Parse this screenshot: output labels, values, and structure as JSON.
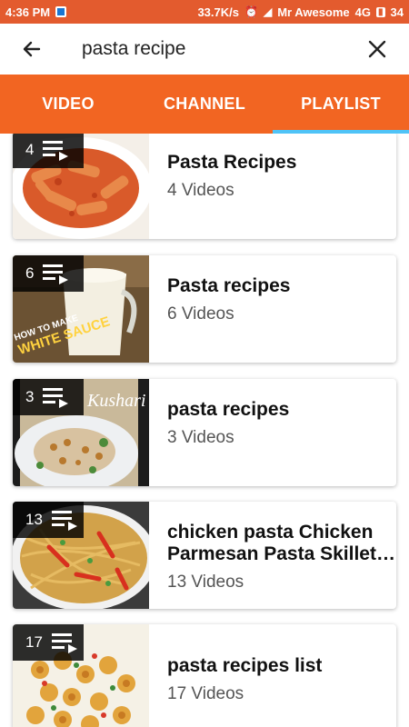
{
  "status_bar": {
    "time": "4:36 PM",
    "speed": "33.7K/s",
    "carrier": "Mr Awesome",
    "network": "4G",
    "battery": "34"
  },
  "search": {
    "query": "pasta recipe"
  },
  "tabs": [
    {
      "label": "VIDEO",
      "active": false
    },
    {
      "label": "CHANNEL",
      "active": false
    },
    {
      "label": "PLAYLIST",
      "active": true
    }
  ],
  "playlists": [
    {
      "count": "4",
      "title": "Pasta Recipes",
      "videos": "4 Videos"
    },
    {
      "count": "6",
      "title": "Pasta recipes",
      "videos": "6 Videos",
      "thumb_text": "HOW TO MAKE WHITE SAUCE"
    },
    {
      "count": "3",
      "title": "pasta recipes",
      "videos": "3 Videos",
      "thumb_text": "Kushari"
    },
    {
      "count": "13",
      "title": "chicken pasta Chicken Parmesan Pasta Skillet…",
      "videos": "13 Videos"
    },
    {
      "count": "17",
      "title": "pasta recipes list",
      "videos": "17 Videos"
    }
  ],
  "colors": {
    "status_bar": "#e35b2e",
    "tab_bar": "#f26522",
    "tab_indicator": "#4fc3f7"
  }
}
